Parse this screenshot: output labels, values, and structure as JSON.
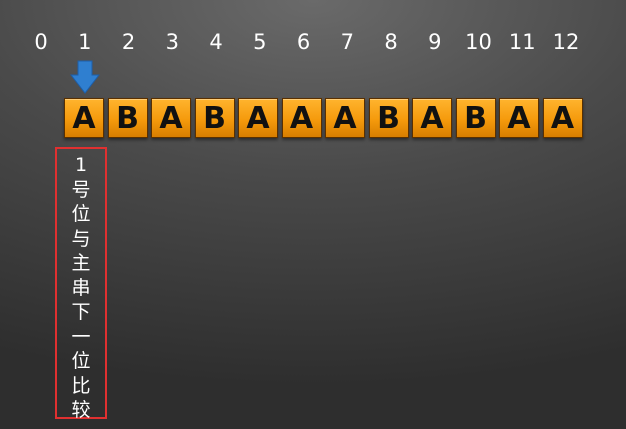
{
  "indices": [
    "0",
    "1",
    "2",
    "3",
    "4",
    "5",
    "6",
    "7",
    "8",
    "9",
    "10",
    "11",
    "12"
  ],
  "cells": [
    "A",
    "B",
    "A",
    "B",
    "A",
    "A",
    "A",
    "B",
    "A",
    "B",
    "A",
    "A"
  ],
  "pointer": {
    "icon": "arrow-down-icon",
    "color": "#2f7fd0",
    "target_index": 1
  },
  "note": {
    "chars": [
      "1",
      "号",
      "位",
      "与",
      "主",
      "串",
      "下",
      "一",
      "位",
      "比",
      "较"
    ],
    "border_color": "#e03030"
  }
}
